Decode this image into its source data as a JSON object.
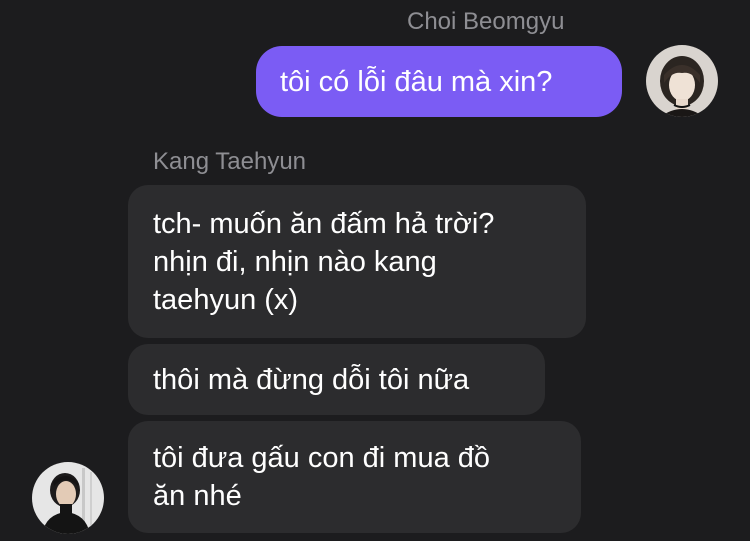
{
  "chat": {
    "outgoing_sender": "Choi Beomgyu",
    "incoming_sender": "Kang Taehyun",
    "messages": [
      {
        "from": "Choi Beomgyu",
        "text": "tôi có lỗi đâu mà xin?"
      },
      {
        "from": "Kang Taehyun",
        "text": "tch- muốn ăn đấm hả trời?\nnhịn đi, nhịn nào kang\ntaehyun (x)"
      },
      {
        "from": "Kang Taehyun",
        "text": "thôi mà đừng dỗi tôi nữa"
      },
      {
        "from": "Kang Taehyun",
        "text": "tôi đưa gấu con đi mua đồ\năn nhé"
      }
    ]
  },
  "colors": {
    "background": "#1c1c1e",
    "outgoing_bubble": "#7b5cf4",
    "incoming_bubble": "#2c2c2e",
    "sender_name": "#8e8e93",
    "message_text": "#ffffff"
  }
}
